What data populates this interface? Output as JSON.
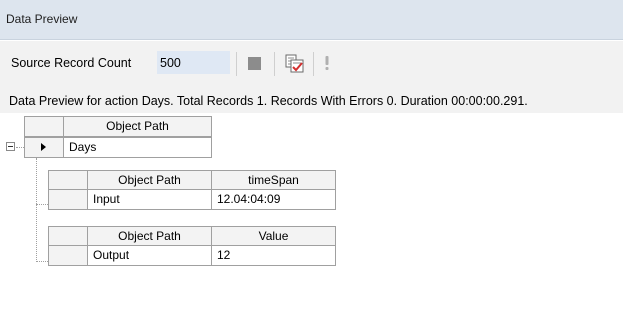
{
  "window": {
    "title": "Data Preview"
  },
  "toolbar": {
    "source_count_label": "Source Record Count",
    "source_count_value": "500",
    "stop_icon": "stop-icon",
    "preview_icon": "preview-check-icon",
    "errors_icon": "exclamation-icon"
  },
  "summary": "Data Preview for action Days. Total Records 1. Records With Errors 0. Duration 00:00:00.291.",
  "grid": {
    "header": "Object Path",
    "root_row": "Days",
    "input_table": {
      "headers": [
        "Object Path",
        "timeSpan"
      ],
      "row": [
        "Input",
        "12.04:04:09"
      ]
    },
    "output_table": {
      "headers": [
        "Object Path",
        "Value"
      ],
      "row": [
        "Output",
        "12"
      ]
    }
  },
  "colors": {
    "titlebar": "#dde5ee",
    "input_bg": "#dfe8f4",
    "toolbar": "#f2f2f2",
    "error_icon": "#d32f2f"
  }
}
